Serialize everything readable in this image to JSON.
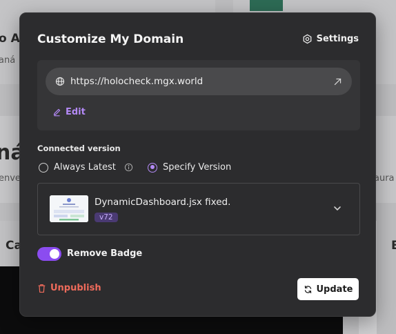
{
  "background": {
    "left_heading_fragment": "o An",
    "left_sub_fragment": "aná",
    "big_heading_fragment": "ná",
    "left_body_fragment": "enve",
    "right_body_fragment": "aura",
    "section_fragment": "Ca",
    "right_section_fragment": "E"
  },
  "modal": {
    "title": "Customize My Domain",
    "settings_label": "Settings",
    "domain": {
      "url": "https://holocheck.mgx.world",
      "edit_label": "Edit"
    },
    "connected_version_label": "Connected version",
    "options": {
      "always_latest": "Always Latest",
      "specify_version": "Specify Version",
      "selected": "specify_version"
    },
    "version": {
      "title": "DynamicDashboard.jsx fixed.",
      "badge": "v72"
    },
    "remove_badge": {
      "label": "Remove Badge",
      "enabled": true
    },
    "unpublish_label": "Unpublish",
    "update_label": "Update"
  },
  "colors": {
    "accent": "#8b4cf0",
    "accent_text": "#b48af7",
    "danger": "#ef6b5b",
    "modal_bg": "#2c2c2e"
  }
}
